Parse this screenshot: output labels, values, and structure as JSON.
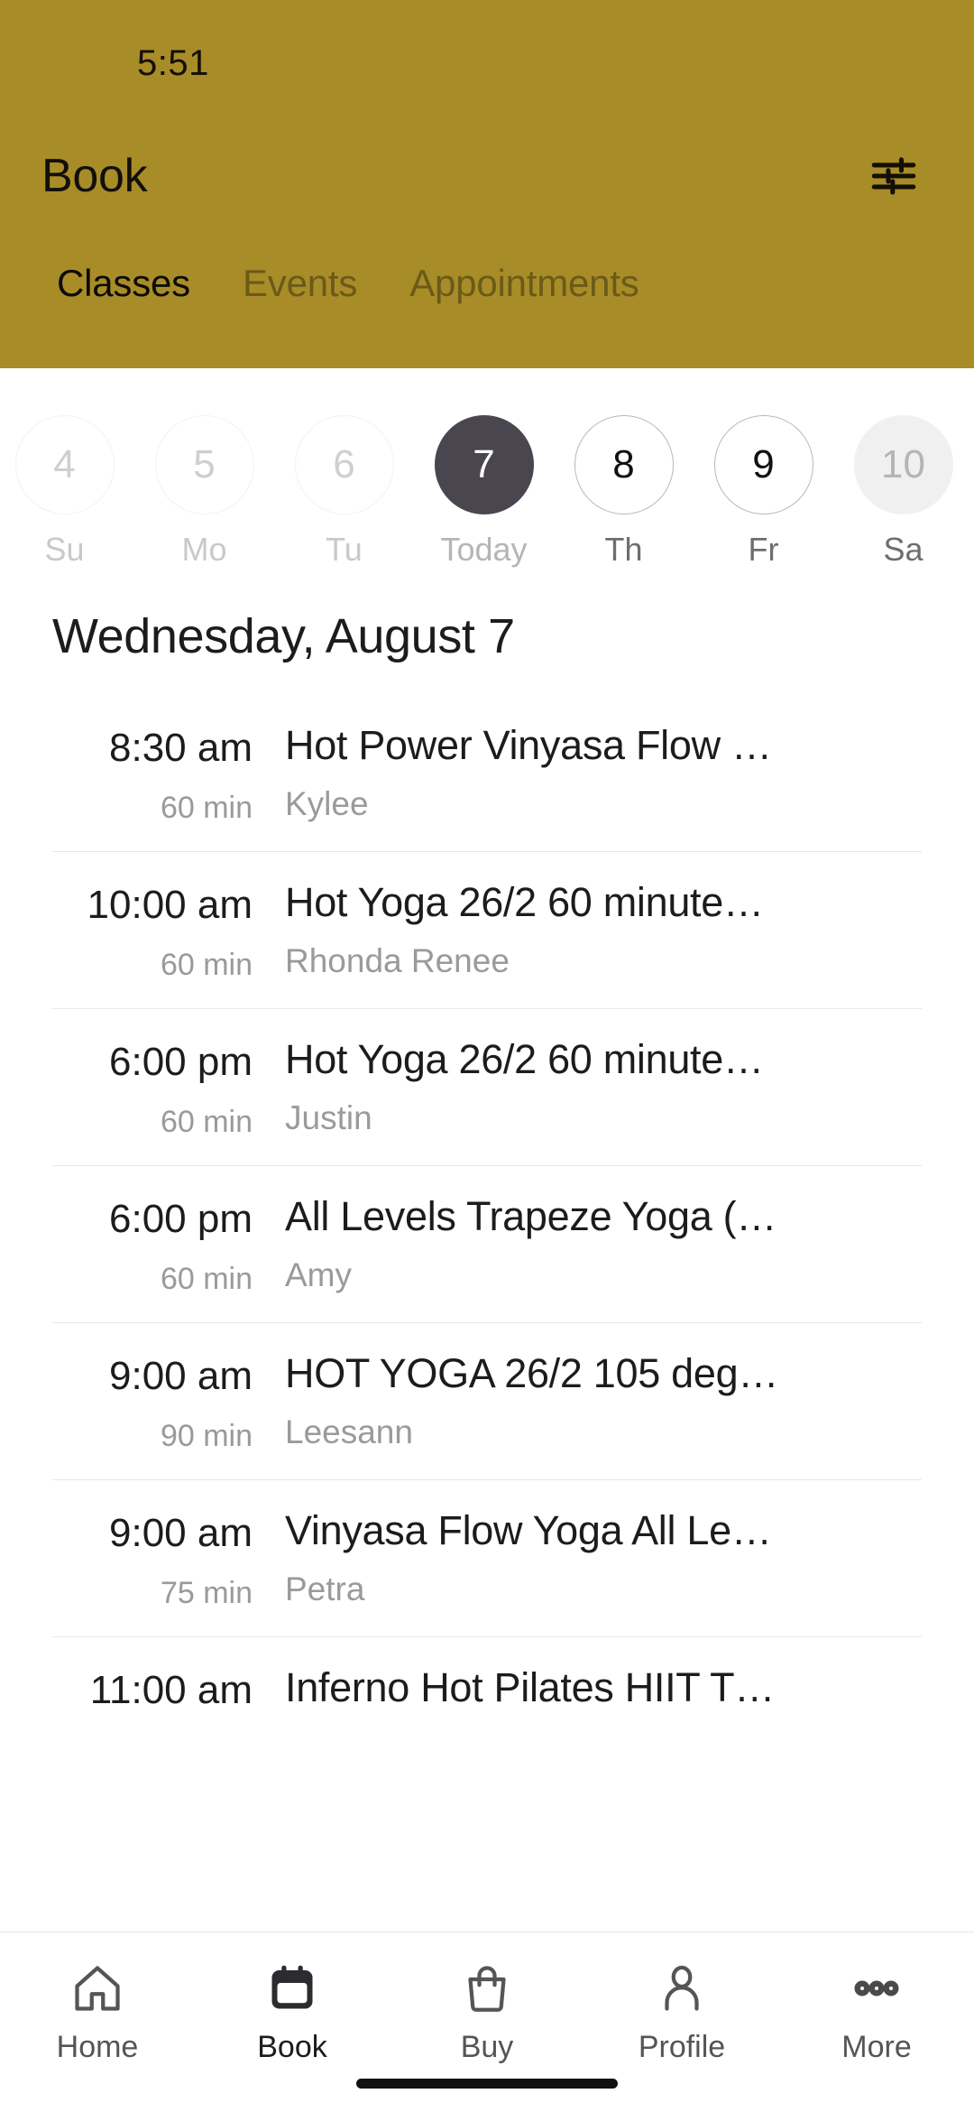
{
  "status_bar": {
    "time": "5:51"
  },
  "header": {
    "title": "Book",
    "filter_icon": "sliders-filter-icon",
    "background_color": "#A88C28",
    "tabs": [
      {
        "label": "Classes",
        "active": true
      },
      {
        "label": "Events",
        "active": false
      },
      {
        "label": "Appointments",
        "active": false
      }
    ]
  },
  "date_strip": {
    "days": [
      {
        "number": "4",
        "weekday": "Su",
        "state": "past"
      },
      {
        "number": "5",
        "weekday": "Mo",
        "state": "past"
      },
      {
        "number": "6",
        "weekday": "Tu",
        "state": "past"
      },
      {
        "number": "7",
        "weekday": "Today",
        "state": "selected"
      },
      {
        "number": "8",
        "weekday": "Th",
        "state": "future"
      },
      {
        "number": "9",
        "weekday": "Fr",
        "state": "future"
      },
      {
        "number": "10",
        "weekday": "Sa",
        "state": "filled"
      }
    ],
    "selected_color": "#4A4650"
  },
  "schedule": {
    "date_heading": "Wednesday, August 7",
    "classes": [
      {
        "time": "8:30 am",
        "duration": "60 min",
        "name": "Hot Power Vinyasa Flow …",
        "instructor": "Kylee"
      },
      {
        "time": "10:00 am",
        "duration": "60 min",
        "name": "Hot Yoga 26/2 60 minute…",
        "instructor": "Rhonda Renee"
      },
      {
        "time": "6:00 pm",
        "duration": "60 min",
        "name": "Hot Yoga 26/2 60 minute…",
        "instructor": "Justin"
      },
      {
        "time": "6:00 pm",
        "duration": "60 min",
        "name": "All Levels Trapeze Yoga (…",
        "instructor": "Amy"
      },
      {
        "time": "9:00 am",
        "duration": "90 min",
        "name": "HOT YOGA 26/2 105 deg…",
        "instructor": "Leesann"
      },
      {
        "time": "9:00 am",
        "duration": "75 min",
        "name": "Vinyasa Flow Yoga All Le…",
        "instructor": "Petra"
      },
      {
        "time": "11:00 am",
        "duration": "",
        "name": "Inferno Hot Pilates HIIT T…",
        "instructor": ""
      }
    ]
  },
  "bottom_nav": {
    "items": [
      {
        "label": "Home",
        "icon": "home-icon",
        "active": false
      },
      {
        "label": "Book",
        "icon": "calendar-icon",
        "active": true
      },
      {
        "label": "Buy",
        "icon": "bag-icon",
        "active": false
      },
      {
        "label": "Profile",
        "icon": "person-icon",
        "active": false
      },
      {
        "label": "More",
        "icon": "more-dots-icon",
        "active": false
      }
    ]
  }
}
